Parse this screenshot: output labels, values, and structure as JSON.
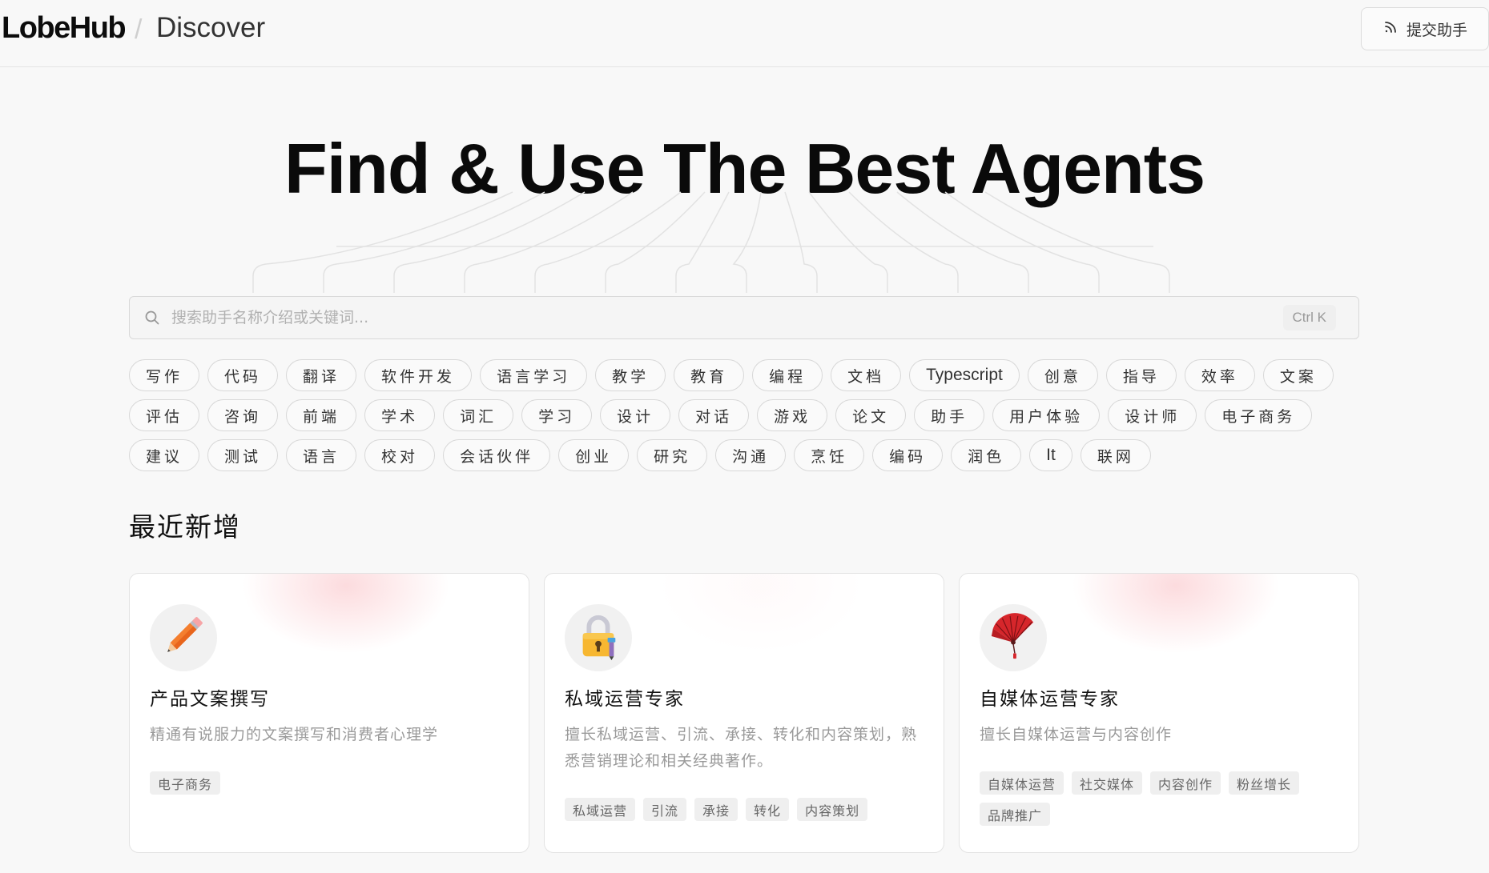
{
  "header": {
    "logo": "LobeHub",
    "separator": "/",
    "breadcrumb": "Discover",
    "submit_label": "提交助手"
  },
  "hero": {
    "title": "Find & Use The Best Agents"
  },
  "search": {
    "placeholder": "搜索助手名称介绍或关键词...",
    "value": "",
    "shortcut": "Ctrl K"
  },
  "tags": [
    "写作",
    "代码",
    "翻译",
    "软件开发",
    "语言学习",
    "教学",
    "教育",
    "编程",
    "文档",
    "Typescript",
    "创意",
    "指导",
    "效率",
    "文案",
    "评估",
    "咨询",
    "前端",
    "学术",
    "词汇",
    "学习",
    "设计",
    "对话",
    "游戏",
    "论文",
    "助手",
    "用户体验",
    "设计师",
    "电子商务",
    "建议",
    "测试",
    "语言",
    "校对",
    "会话伙伴",
    "创业",
    "研究",
    "沟通",
    "烹饪",
    "编码",
    "润色",
    "It",
    "联网"
  ],
  "section": {
    "title": "最近新增"
  },
  "cards": [
    {
      "icon": "pencil-icon",
      "title": "产品文案撰写",
      "description": "精通有说服力的文案撰写和消费者心理学",
      "tags": [
        "电子商务"
      ]
    },
    {
      "icon": "lock-with-pen-icon",
      "title": "私域运营专家",
      "description": "擅长私域运营、引流、承接、转化和内容策划，熟悉营销理论和相关经典著作。",
      "tags": [
        "私域运营",
        "引流",
        "承接",
        "转化",
        "内容策划"
      ]
    },
    {
      "icon": "folding-fan-icon",
      "title": "自媒体运营专家",
      "description": "擅长自媒体运营与内容创作",
      "tags": [
        "自媒体运营",
        "社交媒体",
        "内容创作",
        "粉丝增长",
        "品牌推广"
      ]
    }
  ]
}
